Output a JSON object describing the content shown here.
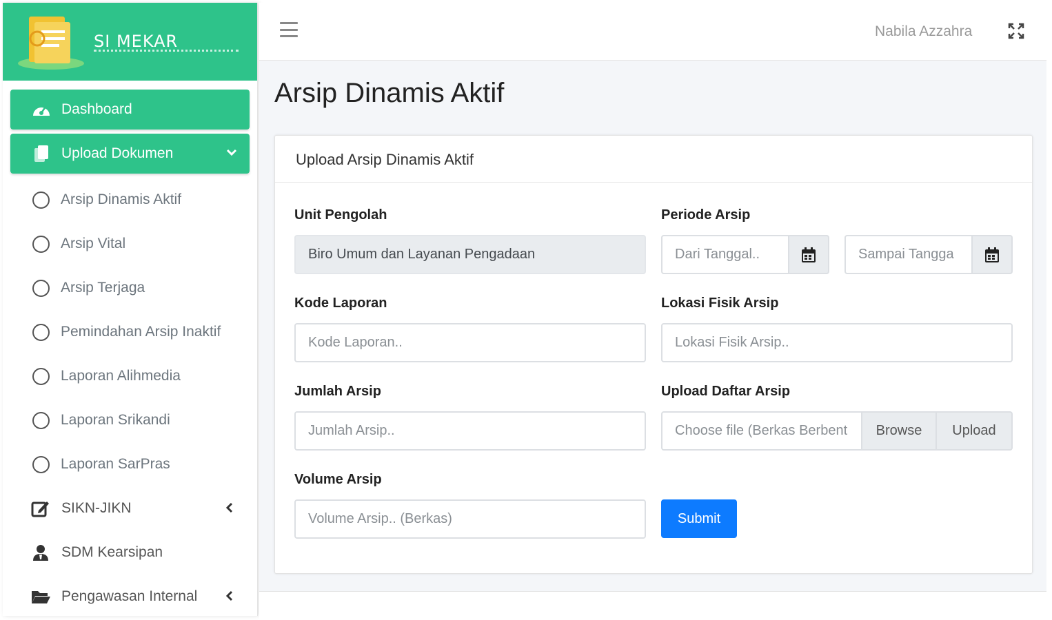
{
  "brand": {
    "name": "SI MEKAR",
    "colors": {
      "primary": "#2ec38a",
      "submit": "#0d7bff"
    }
  },
  "sidebar": {
    "items": [
      {
        "label": "Dashboard",
        "icon": "tachometer-icon",
        "active": true
      },
      {
        "label": "Upload Dokumen",
        "icon": "copy-icon",
        "active": true,
        "expanded": true,
        "children": [
          {
            "label": "Arsip Dinamis Aktif"
          },
          {
            "label": "Arsip Vital"
          },
          {
            "label": "Arsip Terjaga"
          },
          {
            "label": "Pemindahan Arsip Inaktif"
          },
          {
            "label": "Laporan Alihmedia"
          },
          {
            "label": "Laporan Srikandi"
          },
          {
            "label": "Laporan SarPras"
          }
        ]
      },
      {
        "label": "SIKN-JIKN",
        "icon": "edit-icon"
      },
      {
        "label": "SDM Kearsipan",
        "icon": "user-tie-icon"
      },
      {
        "label": "Pengawasan Internal",
        "icon": "folder-open-icon"
      }
    ]
  },
  "topbar": {
    "user_name": "Nabila Azzahra"
  },
  "page": {
    "title": "Arsip Dinamis Aktif"
  },
  "form": {
    "card_title": "Upload Arsip Dinamis Aktif",
    "unit_pengolah": {
      "label": "Unit Pengolah",
      "value": "Biro Umum dan Layanan Pengadaan"
    },
    "periode_arsip": {
      "label": "Periode Arsip",
      "from_placeholder": "Dari Tanggal..",
      "to_placeholder": "Sampai Tangga"
    },
    "kode_laporan": {
      "label": "Kode Laporan",
      "placeholder": "Kode Laporan.."
    },
    "lokasi_fisik": {
      "label": "Lokasi Fisik Arsip",
      "placeholder": "Lokasi Fisik Arsip.."
    },
    "jumlah_arsip": {
      "label": "Jumlah Arsip",
      "placeholder": "Jumlah Arsip.."
    },
    "upload_daftar": {
      "label": "Upload Daftar Arsip",
      "placeholder": "Choose file (Berkas Berbent",
      "browse": "Browse",
      "upload": "Upload"
    },
    "volume_arsip": {
      "label": "Volume Arsip",
      "placeholder": "Volume Arsip.. (Berkas)"
    },
    "submit_label": "Submit"
  }
}
